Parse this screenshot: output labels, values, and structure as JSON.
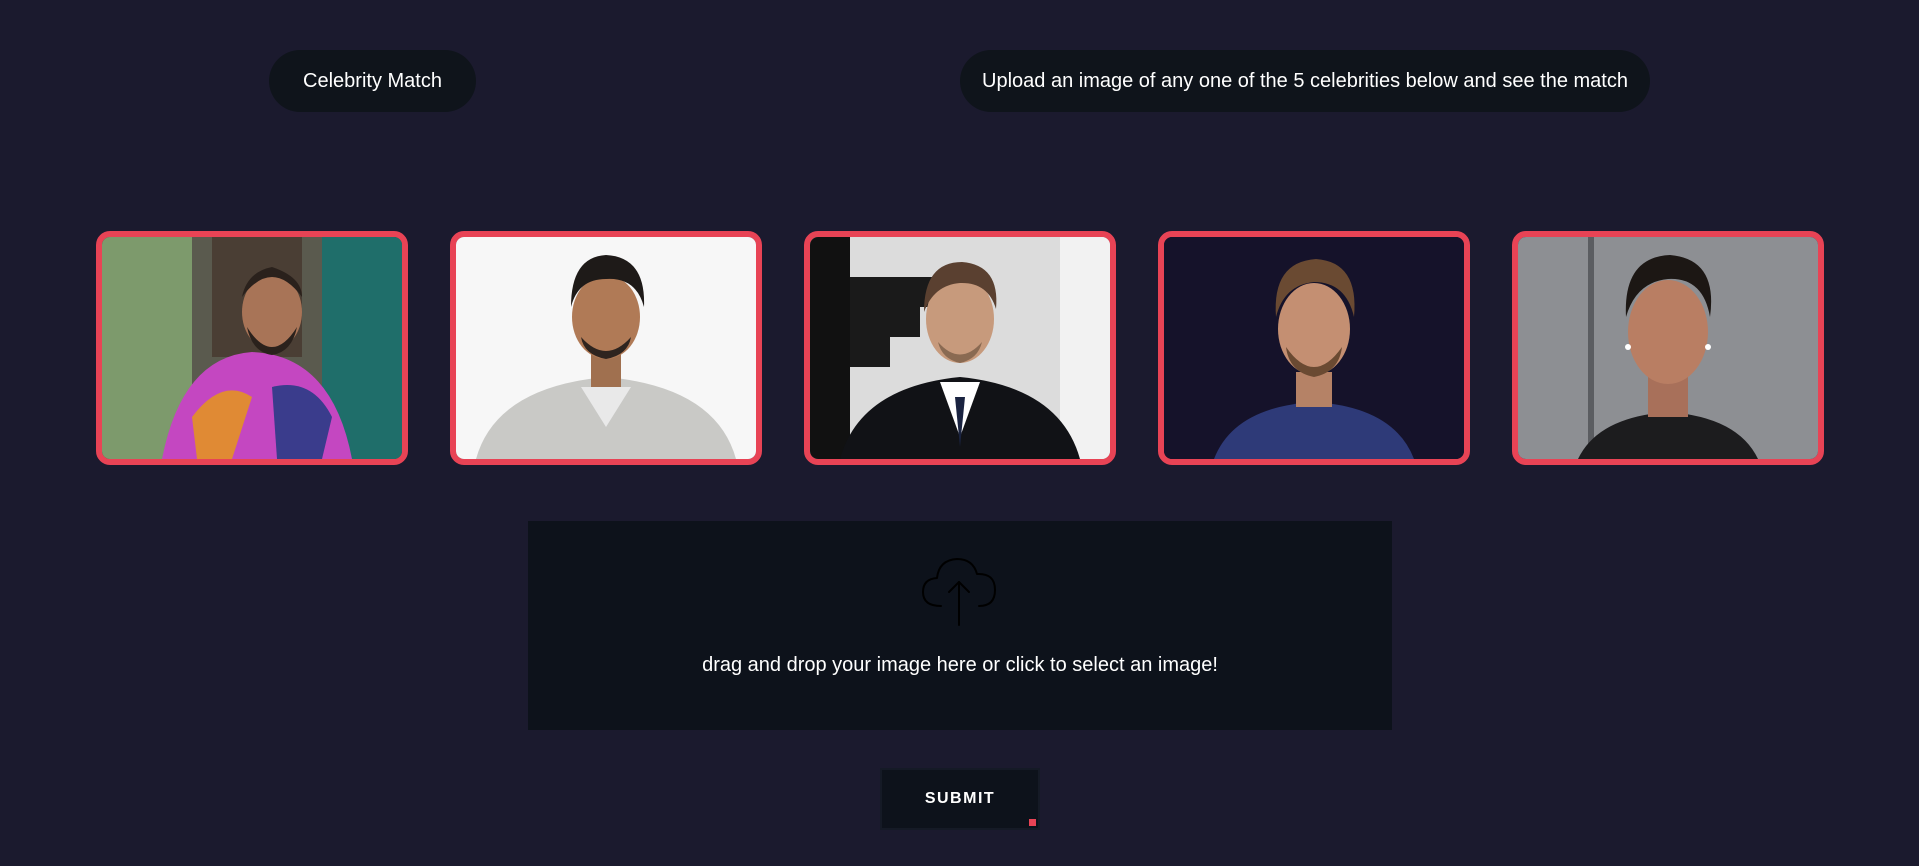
{
  "header": {
    "title": "Celebrity Match",
    "subtitle": "Upload an image of any one of the 5 celebrities below and see the match"
  },
  "gallery": {
    "items": [
      {
        "photo_icon": "celebrity-photo-1"
      },
      {
        "photo_icon": "celebrity-photo-2"
      },
      {
        "photo_icon": "celebrity-photo-3"
      },
      {
        "photo_icon": "celebrity-photo-4"
      },
      {
        "photo_icon": "celebrity-photo-5"
      }
    ]
  },
  "upload": {
    "icon": "cloud-upload-icon",
    "prompt": "drag and drop your image here or click to select an image!"
  },
  "submit": {
    "label": "SUBMIT"
  },
  "colors": {
    "background": "#1b1a2e",
    "panel": "#0d121b",
    "accent": "#e84355",
    "text": "#ffffff"
  }
}
